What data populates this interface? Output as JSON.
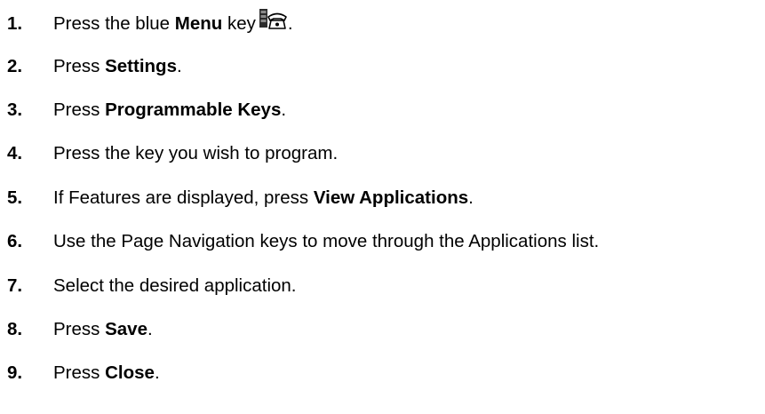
{
  "steps": [
    {
      "number": "1.",
      "before": "Press the blue ",
      "bold": "Menu",
      "after": " key",
      "icon": "menu-key-icon",
      "trail": "."
    },
    {
      "number": "2.",
      "before": "Press ",
      "bold": "Settings",
      "after": "."
    },
    {
      "number": "3.",
      "before": "Press ",
      "bold": "Programmable Keys",
      "after": "."
    },
    {
      "number": "4.",
      "before": "Press the key you wish to program.",
      "bold": "",
      "after": ""
    },
    {
      "number": "5.",
      "before": "If Features are displayed, press ",
      "bold": "View Applications",
      "after": "."
    },
    {
      "number": "6.",
      "before": "Use the Page Navigation keys to move through the Applications list.",
      "bold": "",
      "after": ""
    },
    {
      "number": "7.",
      "before": "Select the desired application.",
      "bold": "",
      "after": ""
    },
    {
      "number": "8.",
      "before": "Press ",
      "bold": "Save",
      "after": "."
    },
    {
      "number": "9.",
      "before": "Press ",
      "bold": "Close",
      "after": "."
    }
  ]
}
